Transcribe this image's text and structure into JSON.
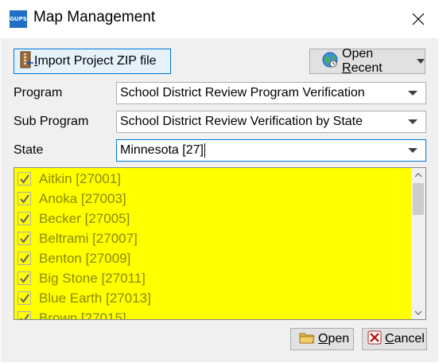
{
  "window": {
    "app_icon_text": "GUPS",
    "title": "Map Management"
  },
  "toolbar": {
    "import_label_pre": "",
    "import_label_u": "I",
    "import_label_post": "mport Project ZIP file",
    "recent_label_pre": "Open ",
    "recent_label_u": "R",
    "recent_label_post": "ecent"
  },
  "form": {
    "program_label": "Program",
    "program_value": "School District Review Program Verification",
    "sub_program_label": "Sub Program",
    "sub_program_value": "School District Review Verification by State",
    "state_label": "State",
    "state_value": "Minnesota [27]"
  },
  "county_list": {
    "items": [
      {
        "label": "Aitkin [27001]",
        "checked": true
      },
      {
        "label": "Anoka [27003]",
        "checked": true
      },
      {
        "label": "Becker [27005]",
        "checked": true
      },
      {
        "label": "Beltrami [27007]",
        "checked": true
      },
      {
        "label": "Benton [27009]",
        "checked": true
      },
      {
        "label": "Big Stone [27011]",
        "checked": true
      },
      {
        "label": "Blue Earth [27013]",
        "checked": true
      },
      {
        "label": "Brown [27015]",
        "checked": true
      }
    ],
    "background_color": "#ffff00"
  },
  "footer": {
    "open_u": "O",
    "open_post": "pen",
    "cancel_u": "C",
    "cancel_post": "ancel"
  }
}
